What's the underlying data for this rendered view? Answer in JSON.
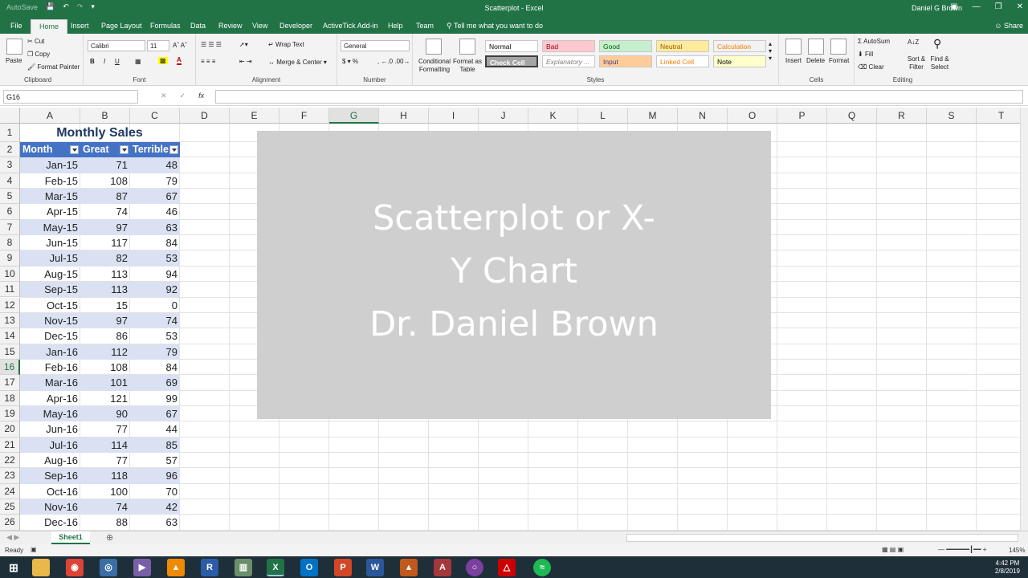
{
  "window": {
    "title": "Scatterplot - Excel",
    "user": "Daniel G Brown",
    "autosave": "AutoSave",
    "share": "Share"
  },
  "tabs": [
    "File",
    "Home",
    "Insert",
    "Page Layout",
    "Formulas",
    "Data",
    "Review",
    "View",
    "Developer",
    "ActiveTick Add-in",
    "Help",
    "Team"
  ],
  "tell_me": "Tell me what you want to do",
  "ribbon": {
    "clipboard": {
      "paste": "Paste",
      "cut": "Cut",
      "copy": "Copy",
      "format_painter": "Format Painter",
      "label": "Clipboard"
    },
    "font": {
      "name": "Calibri",
      "size": "11",
      "label": "Font"
    },
    "alignment": {
      "wrap": "Wrap Text",
      "merge": "Merge & Center",
      "label": "Alignment"
    },
    "number": {
      "format": "General",
      "label": "Number"
    },
    "styles": {
      "conditional": "Conditional Formatting",
      "format_table": "Format as Table",
      "cells": [
        {
          "name": "Normal",
          "bg": "#ffffff",
          "fg": "#000000"
        },
        {
          "name": "Bad",
          "bg": "#ffc7ce",
          "fg": "#9c0006"
        },
        {
          "name": "Good",
          "bg": "#c6efce",
          "fg": "#006100"
        },
        {
          "name": "Neutral",
          "bg": "#ffeb9c",
          "fg": "#9c5700"
        },
        {
          "name": "Calculation",
          "bg": "#f2f2f2",
          "fg": "#fa7d00"
        },
        {
          "name": "Check Cell",
          "bg": "#a5a5a5",
          "fg": "#ffffff"
        },
        {
          "name": "Explanatory ...",
          "bg": "#ffffff",
          "fg": "#7f7f7f"
        },
        {
          "name": "Input",
          "bg": "#ffcc99",
          "fg": "#3f3f76"
        },
        {
          "name": "Linked Cell",
          "bg": "#ffffff",
          "fg": "#fa7d00"
        },
        {
          "name": "Note",
          "bg": "#ffffcc",
          "fg": "#000000"
        }
      ],
      "label": "Styles"
    },
    "cells": {
      "insert": "Insert",
      "delete": "Delete",
      "format": "Format",
      "label": "Cells"
    },
    "editing": {
      "autosum": "AutoSum",
      "fill": "Fill",
      "clear": "Clear",
      "sort": "Sort & Filter",
      "find": "Find & Select",
      "label": "Editing"
    }
  },
  "name_box": "G16",
  "columns": [
    "A",
    "B",
    "C",
    "D",
    "E",
    "F",
    "G",
    "H",
    "I",
    "J",
    "K",
    "L",
    "M",
    "N",
    "O",
    "P",
    "Q",
    "R",
    "S",
    "T"
  ],
  "selected_column": "G",
  "selected_row": 16,
  "sheet": {
    "title": "Monthly Sales",
    "headers": [
      "Month",
      "Great",
      "Terrible"
    ],
    "rows": [
      [
        "Jan-15",
        "71",
        "48"
      ],
      [
        "Feb-15",
        "108",
        "79"
      ],
      [
        "Mar-15",
        "87",
        "67"
      ],
      [
        "Apr-15",
        "74",
        "46"
      ],
      [
        "May-15",
        "97",
        "63"
      ],
      [
        "Jun-15",
        "117",
        "84"
      ],
      [
        "Jul-15",
        "82",
        "53"
      ],
      [
        "Aug-15",
        "113",
        "94"
      ],
      [
        "Sep-15",
        "113",
        "92"
      ],
      [
        "Oct-15",
        "15",
        "0"
      ],
      [
        "Nov-15",
        "97",
        "74"
      ],
      [
        "Dec-15",
        "86",
        "53"
      ],
      [
        "Jan-16",
        "112",
        "79"
      ],
      [
        "Feb-16",
        "108",
        "84"
      ],
      [
        "Mar-16",
        "101",
        "69"
      ],
      [
        "Apr-16",
        "121",
        "99"
      ],
      [
        "May-16",
        "90",
        "67"
      ],
      [
        "Jun-16",
        "77",
        "44"
      ],
      [
        "Jul-16",
        "114",
        "85"
      ],
      [
        "Aug-16",
        "77",
        "57"
      ],
      [
        "Sep-16",
        "118",
        "96"
      ],
      [
        "Oct-16",
        "100",
        "70"
      ],
      [
        "Nov-16",
        "74",
        "42"
      ],
      [
        "Dec-16",
        "88",
        "63"
      ]
    ]
  },
  "overlay": {
    "line1": "Scatterplot or X-",
    "line2": "Y Chart",
    "line3": "Dr. Daniel Brown"
  },
  "sheet_tab": "Sheet1",
  "status": {
    "ready": "Ready",
    "zoom": "145%"
  },
  "clock": {
    "time": "4:42 PM",
    "date": "2/8/2019"
  }
}
